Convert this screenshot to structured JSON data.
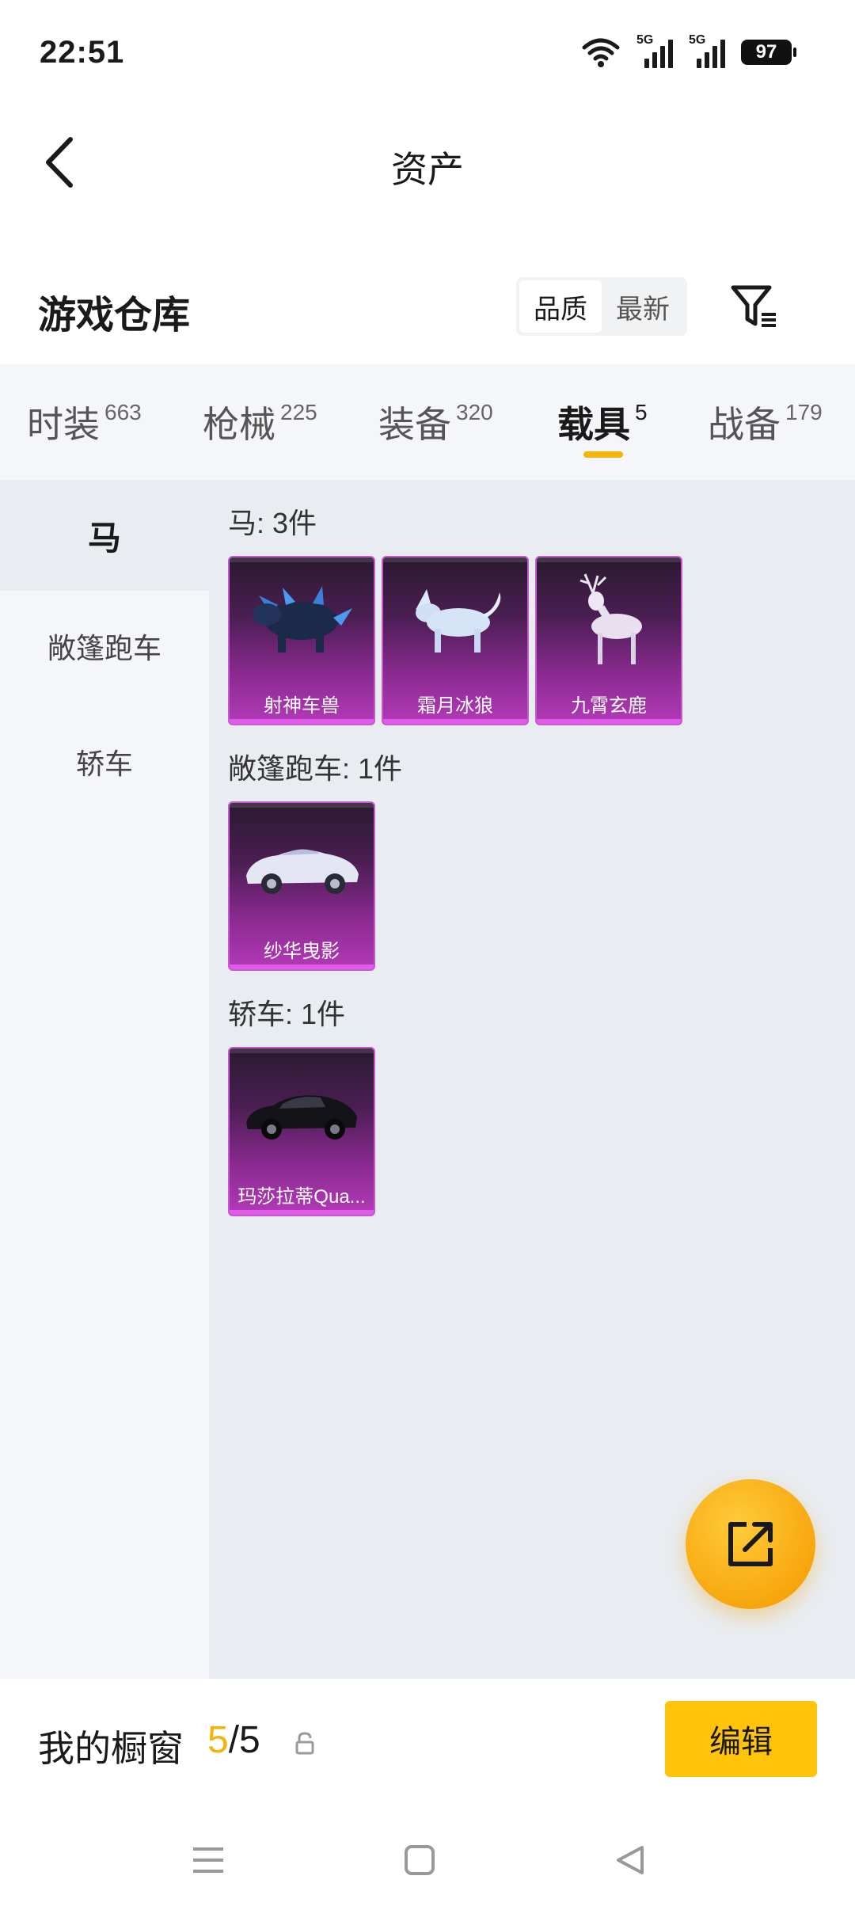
{
  "status_bar": {
    "time": "22:51",
    "net1": "5G",
    "net2": "5G",
    "battery": "97"
  },
  "header": {
    "title": "资产"
  },
  "warehouse": {
    "title": "游戏仓库",
    "sort_options": [
      "品质",
      "最新"
    ],
    "active_sort": "品质"
  },
  "tabs": [
    {
      "label": "时装",
      "count": "663"
    },
    {
      "label": "枪械",
      "count": "225"
    },
    {
      "label": "装备",
      "count": "320"
    },
    {
      "label": "载具",
      "count": "5",
      "active": true
    },
    {
      "label": "战备",
      "count": "179"
    }
  ],
  "sidebar": {
    "items": [
      {
        "label": "马",
        "active": true
      },
      {
        "label": "敞篷跑车"
      },
      {
        "label": "轿车"
      }
    ]
  },
  "groups": [
    {
      "label": "马: 3件",
      "items": [
        {
          "name": "射神车兽",
          "icon": "dark-beast-icon"
        },
        {
          "name": "霜月冰狼",
          "icon": "ice-wolf-icon"
        },
        {
          "name": "九霄玄鹿",
          "icon": "white-deer-icon"
        }
      ]
    },
    {
      "label": "敞篷跑车: 1件",
      "items": [
        {
          "name": "纱华曳影",
          "icon": "white-convertible-icon"
        }
      ]
    },
    {
      "label": "轿车: 1件",
      "items": [
        {
          "name": "玛莎拉蒂Qua...",
          "icon": "black-sedan-icon"
        }
      ]
    }
  ],
  "showcase": {
    "label": "我的橱窗",
    "current": "5",
    "separator": "/",
    "total": "5",
    "edit_label": "编辑"
  },
  "colors": {
    "accent": "#f5b40a",
    "card_purple": "#8a2a90"
  }
}
